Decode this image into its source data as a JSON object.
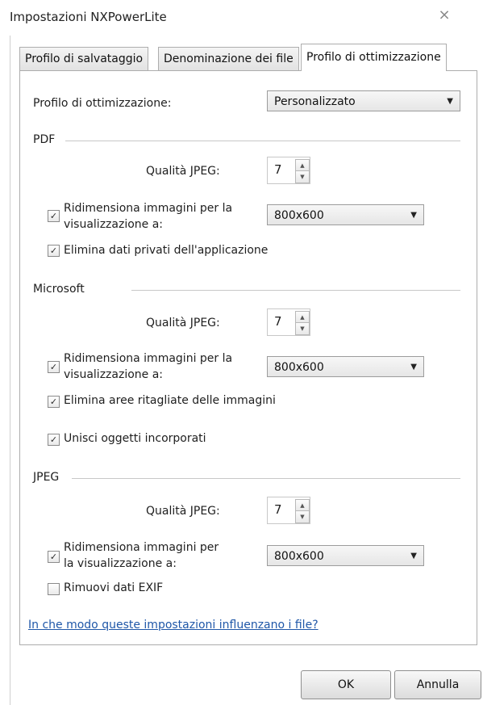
{
  "window": {
    "title": "Impostazioni NXPowerLite",
    "close_glyph": "⨯"
  },
  "tabs": [
    {
      "label": "Profilo di salvataggio"
    },
    {
      "label": "Denominazione dei file"
    },
    {
      "label": "Profilo di ottimizzazione",
      "active": true
    }
  ],
  "profile": {
    "label": "Profilo di ottimizzazione:",
    "value": "Personalizzato"
  },
  "pdf": {
    "title": "PDF",
    "jpeg_label": "Qualità JPEG:",
    "jpeg_value": "7",
    "resize_label": "Ridimensiona immagini per la visualizzazione a:",
    "resize_checked": true,
    "resize_value": "800x600",
    "private_label": "Elimina dati privati dell'applicazione",
    "private_checked": true
  },
  "microsoft": {
    "title": "Microsoft",
    "jpeg_label": "Qualità JPEG:",
    "jpeg_value": "7",
    "resize_label": "Ridimensiona immagini per la visualizzazione a:",
    "resize_checked": true,
    "resize_value": "800x600",
    "crop_label": "Elimina aree ritagliate delle immagini",
    "crop_checked": true,
    "merge_label": "Unisci oggetti incorporati",
    "merge_checked": true
  },
  "jpeg": {
    "title": "JPEG",
    "jpeg_label": "Qualità JPEG:",
    "jpeg_value": "7",
    "resize_label": "Ridimensiona immagini per la visualizzazione a:",
    "resize_checked": true,
    "resize_value": "800x600",
    "exif_label": "Rimuovi dati EXIF",
    "exif_checked": false
  },
  "help_link": "In che modo queste impostazioni influenzano i file?",
  "buttons": {
    "ok": "OK",
    "cancel": "Annulla"
  },
  "glyphs": {
    "check": "✓",
    "dropdown": "▼",
    "spin_up": "▲",
    "spin_down": "▼"
  }
}
